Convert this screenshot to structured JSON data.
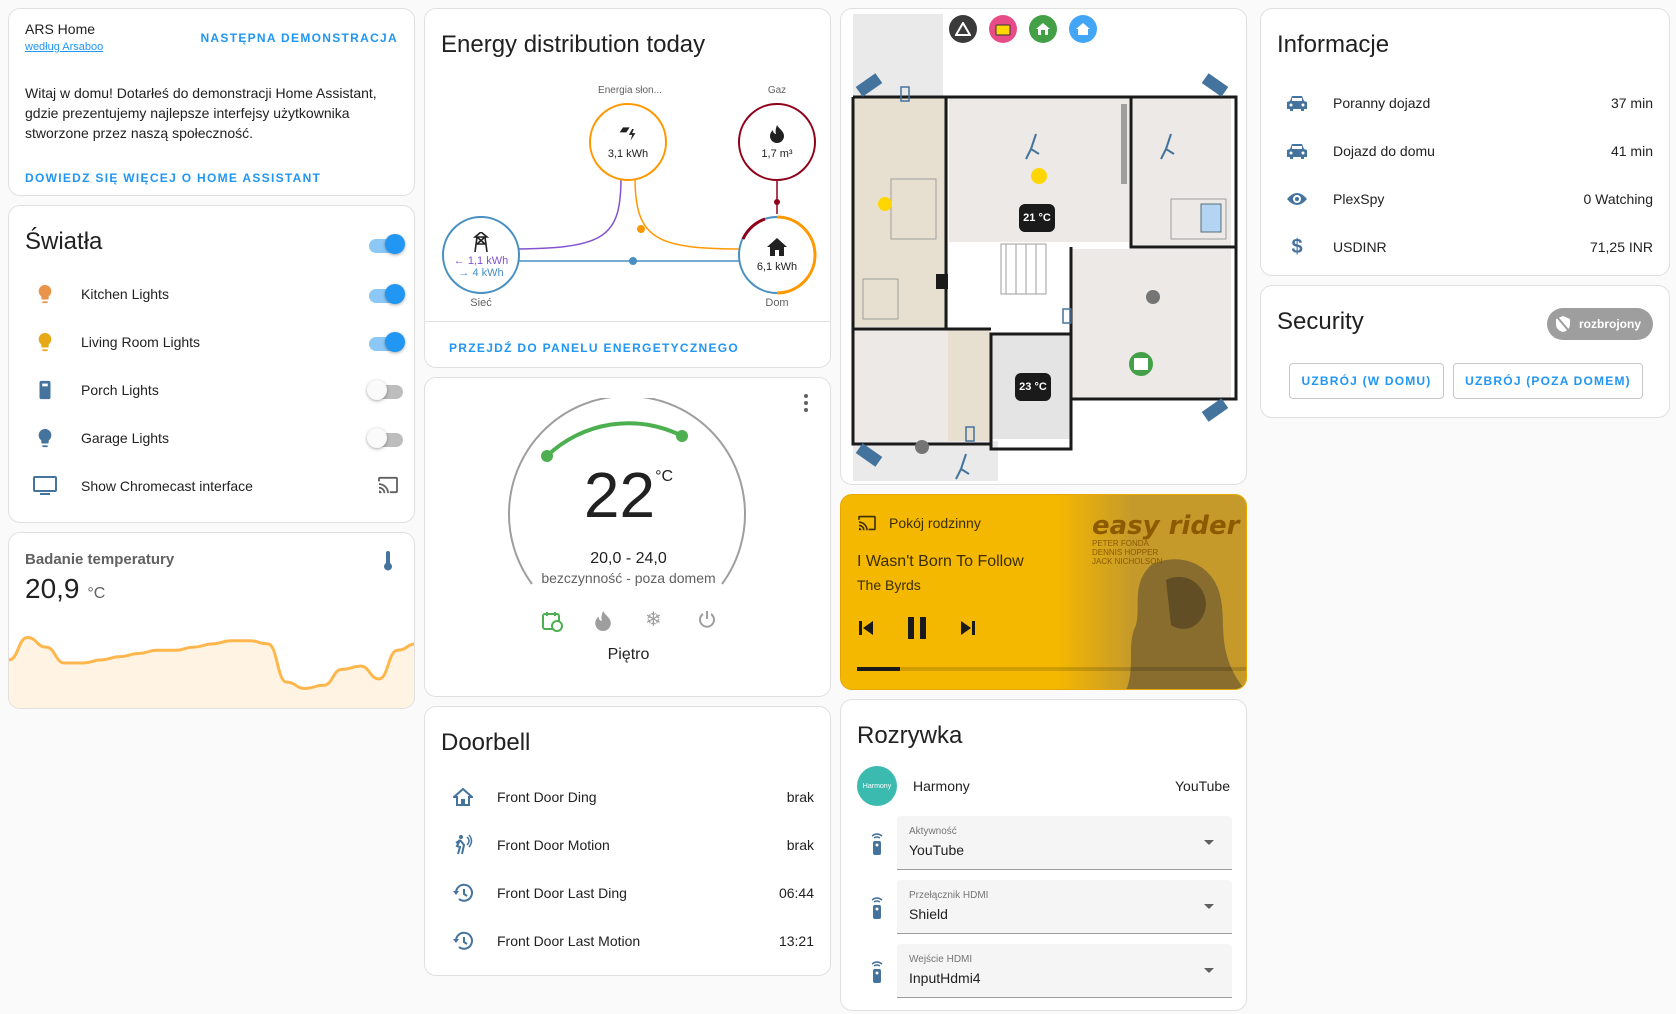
{
  "intro": {
    "title": "ARS Home",
    "author_link": "według Arsaboo",
    "next_demo": "NASTĘPNA DEMONSTRACJA",
    "description": "Witaj w domu! Dotarłeś do demonstracji Home Assistant, gdzie prezentujemy najlepsze interfejsy użytkownika stworzone przez naszą społeczność.",
    "learn_more": "DOWIEDZ SIĘ WIĘCEJ O HOME ASSISTANT"
  },
  "lights": {
    "title": "Światła",
    "master_on": true,
    "items": [
      {
        "label": "Kitchen Lights",
        "icon": "lightbulb-icon",
        "color": "#e8944a",
        "state": "on"
      },
      {
        "label": "Living Room Lights",
        "icon": "lightbulb-icon",
        "color": "#e6a817",
        "state": "on"
      },
      {
        "label": "Porch Lights",
        "icon": "lamp-icon",
        "color": "#44739e",
        "state": "off"
      },
      {
        "label": "Garage Lights",
        "icon": "lightbulb-icon",
        "color": "#44739e",
        "state": "off"
      },
      {
        "label": "Show Chromecast interface",
        "icon": "television-icon",
        "color": "#44739e",
        "state": "cast"
      }
    ]
  },
  "temperature": {
    "title": "Badanie temperatury",
    "value": "20,9",
    "unit": "°C",
    "history": [
      12,
      19,
      16,
      11,
      11,
      12,
      13,
      14,
      15,
      15,
      16,
      17,
      18,
      18,
      17,
      5,
      3,
      4,
      9,
      10,
      6,
      15,
      17
    ]
  },
  "energy": {
    "title": "Energy distribution today",
    "solar": {
      "label": "Energia słon...",
      "value": "3,1 kWh"
    },
    "gas": {
      "label": "Gaz",
      "value": "1,7 m³"
    },
    "grid": {
      "label": "Sieć",
      "in": "1,1 kWh",
      "out": "4 kWh"
    },
    "home": {
      "label": "Dom",
      "value": "6,1 kWh"
    },
    "link": "PRZEJDŹ DO PANELU ENERGETYCZNEGO"
  },
  "thermostat": {
    "current": "22",
    "unit": "°C",
    "range": "20,0 - 24,0",
    "status": "bezczynność - poza domem",
    "name": "Piętro",
    "modes": [
      "schedule-icon",
      "flame-icon",
      "snowflake-icon",
      "power-icon"
    ]
  },
  "doorbell": {
    "title": "Doorbell",
    "items": [
      {
        "label": "Front Door Ding",
        "icon": "home-icon",
        "value": "brak"
      },
      {
        "label": "Front Door Motion",
        "icon": "motion-icon",
        "value": "brak"
      },
      {
        "label": "Front Door Last Ding",
        "icon": "history-icon",
        "value": "06:44"
      },
      {
        "label": "Front Door Last Motion",
        "icon": "history-icon",
        "value": "13:21"
      }
    ]
  },
  "floorplan": {
    "temp1": "21 °C",
    "temp2": "23 °C"
  },
  "media": {
    "source": "Pokój rodzinny",
    "title": "I Wasn't Born To Follow",
    "artist": "The Byrds",
    "progress": 0.11,
    "album_line1": "easy rider",
    "album_line2": "PETER FONDA",
    "album_line3": "DENNIS HOPPER",
    "album_line4": "JACK NICHOLSON"
  },
  "entertainment": {
    "title": "Rozrywka",
    "harmony_name": "Harmony",
    "harmony_logo": "Harmony",
    "harmony_value": "YouTube",
    "selects": [
      {
        "label": "Aktywność",
        "value": "YouTube"
      },
      {
        "label": "Przełącznik HDMI",
        "value": "Shield"
      },
      {
        "label": "Wejście HDMI",
        "value": "InputHdmi4"
      }
    ]
  },
  "info": {
    "title": "Informacje",
    "items": [
      {
        "label": "Poranny dojazd",
        "icon": "car-icon",
        "value": "37 min"
      },
      {
        "label": "Dojazd do domu",
        "icon": "car-icon",
        "value": "41 min"
      },
      {
        "label": "PlexSpy",
        "icon": "eye-icon",
        "value": "0 Watching"
      },
      {
        "label": "USDINR",
        "icon": "dollar-icon",
        "value": "71,25 INR"
      }
    ]
  },
  "security": {
    "title": "Security",
    "state": "rozbrojony",
    "arm_home": "UZBRÓJ (W DOMU)",
    "arm_away": "UZBRÓJ (POZA DOMEM)"
  },
  "colors": {
    "accent": "#2196f3",
    "icon": "#44739e",
    "solar": "#ff9800",
    "gas": "#8e021b",
    "grid": "#488fc2",
    "return": "#8353d1",
    "media_bg": "#f5b800",
    "thermo_active": "#4caf50"
  }
}
